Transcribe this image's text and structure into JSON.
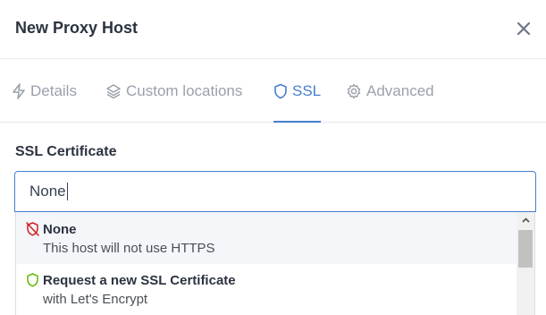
{
  "modal": {
    "title": "New Proxy Host",
    "close_icon": "close-icon"
  },
  "tabs": [
    {
      "label": "Details",
      "icon": "bolt-icon",
      "active": false
    },
    {
      "label": "Custom locations",
      "icon": "layers-icon",
      "active": false
    },
    {
      "label": "SSL",
      "icon": "shield-icon",
      "active": true
    },
    {
      "label": "Advanced",
      "icon": "gear-icon",
      "active": false
    }
  ],
  "ssl": {
    "field_label": "SSL Certificate",
    "input_value": "None",
    "options": [
      {
        "title": "None",
        "subtitle": "This host will not use HTTPS",
        "icon": "shield-off-icon",
        "icon_color": "#cd201f"
      },
      {
        "title": "Request a new SSL Certificate",
        "subtitle": "with Let's Encrypt",
        "icon": "shield-icon",
        "icon_color": "#5eba00"
      }
    ]
  },
  "colors": {
    "accent": "#467fcf",
    "muted": "#9aa0ac",
    "danger": "#cd201f",
    "success": "#5eba00"
  }
}
